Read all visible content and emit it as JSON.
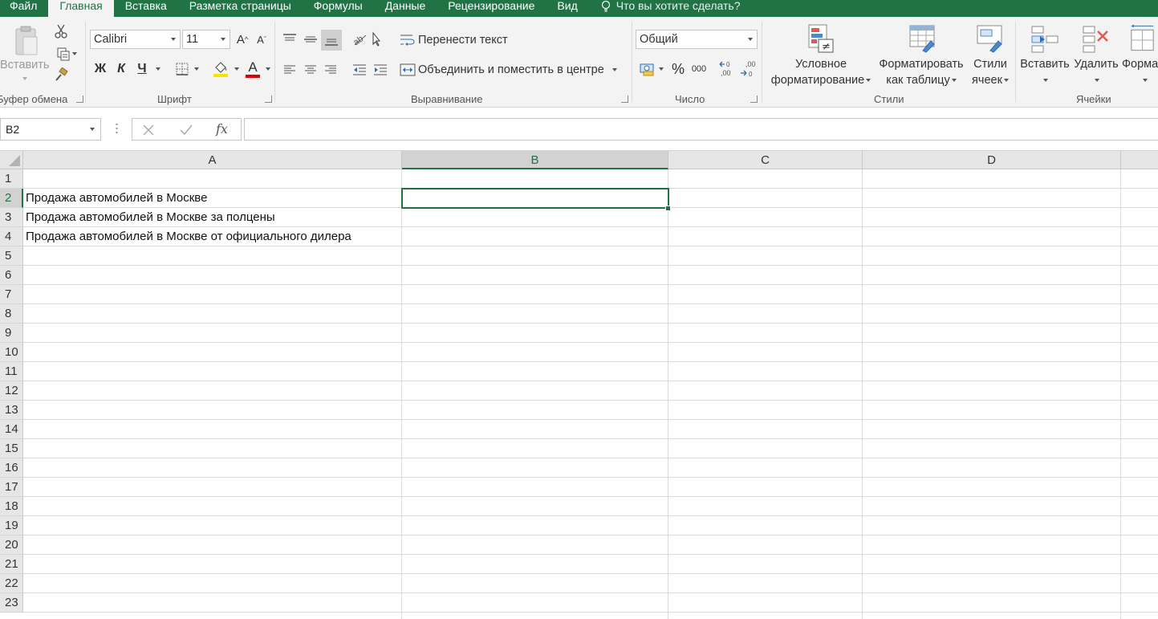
{
  "menu": {
    "tabs": [
      "Файл",
      "Главная",
      "Вставка",
      "Разметка страницы",
      "Формулы",
      "Данные",
      "Рецензирование",
      "Вид"
    ],
    "active_index": 1,
    "search_placeholder": "Что вы хотите сделать?"
  },
  "ribbon": {
    "clipboard": {
      "label": "Буфер обмена",
      "paste_label": "Вставить"
    },
    "font": {
      "label": "Шрифт",
      "font_name": "Calibri",
      "font_size": "11",
      "bold": "Ж",
      "italic": "К",
      "underline": "Ч",
      "grow": "A",
      "shrink": "A",
      "color_letter": "A",
      "highlight_color": "#f5e400",
      "font_color": "#e00000"
    },
    "alignment": {
      "label": "Выравнивание",
      "wrap_text": "Перенести текст",
      "merge_center": "Объединить и поместить в центре"
    },
    "number": {
      "label": "Число",
      "format": "Общий",
      "percent": "%",
      "thousands": "000",
      "inc_decimal": ",00",
      "dec_decimal": ",00"
    },
    "styles": {
      "label": "Стили",
      "conditional_line1": "Условное",
      "conditional_line2": "форматирование",
      "format_table_line1": "Форматировать",
      "format_table_line2": "как таблицу",
      "cell_styles_line1": "Стили",
      "cell_styles_line2": "ячеек"
    },
    "cells": {
      "label": "Ячейки",
      "insert": "Вставить",
      "delete": "Удалить",
      "format": "Форма"
    }
  },
  "formula_bar": {
    "name_box": "B2",
    "fx": "fx",
    "value": ""
  },
  "grid": {
    "columns": [
      "A",
      "B",
      "C",
      "D"
    ],
    "selected_column": "B",
    "rows": [
      "1",
      "2",
      "3",
      "4",
      "5",
      "6",
      "7",
      "8",
      "9",
      "10",
      "11",
      "12",
      "13",
      "14",
      "15",
      "16",
      "17",
      "18",
      "19",
      "20",
      "21",
      "22",
      "23"
    ],
    "selected_row": "2",
    "cells": {
      "A2": "Продажа автомобилей в Москве",
      "A3": "Продажа автомобилей в Москве за полцены",
      "A4": "Продажа автомобилей в Москве от официального дилера"
    }
  },
  "colors": {
    "accent": "#217346",
    "ribbon_bg": "#f3f3f3",
    "header_bg": "#e6e6e6",
    "gridline": "#dadada"
  }
}
